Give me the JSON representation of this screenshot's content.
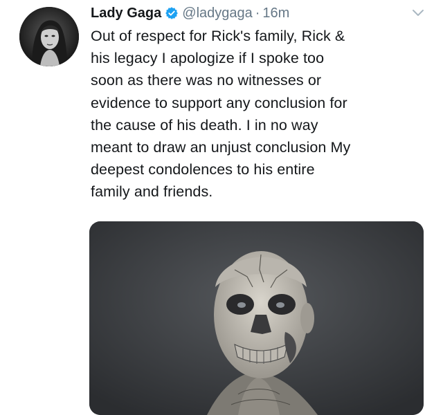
{
  "tweet": {
    "author": {
      "display_name": "Lady Gaga",
      "handle": "@ladygaga",
      "verified": true
    },
    "separator": "·",
    "timestamp": "16m",
    "text_lines": [
      "Out of respect for Rick's family, Rick &",
      "his legacy I apologize if I spoke too",
      "soon as there was no witnesses or",
      "evidence to support any conclusion for",
      "the cause of his death. I in no way",
      "meant to draw an unjust conclusion My",
      "deepest condolences to his entire",
      "family and friends."
    ],
    "icons": {
      "verified": "verified-badge-icon",
      "menu": "chevron-down-icon"
    },
    "colors": {
      "verified_blue": "#1da1f2",
      "text": "#14171a",
      "muted": "#657786"
    }
  }
}
